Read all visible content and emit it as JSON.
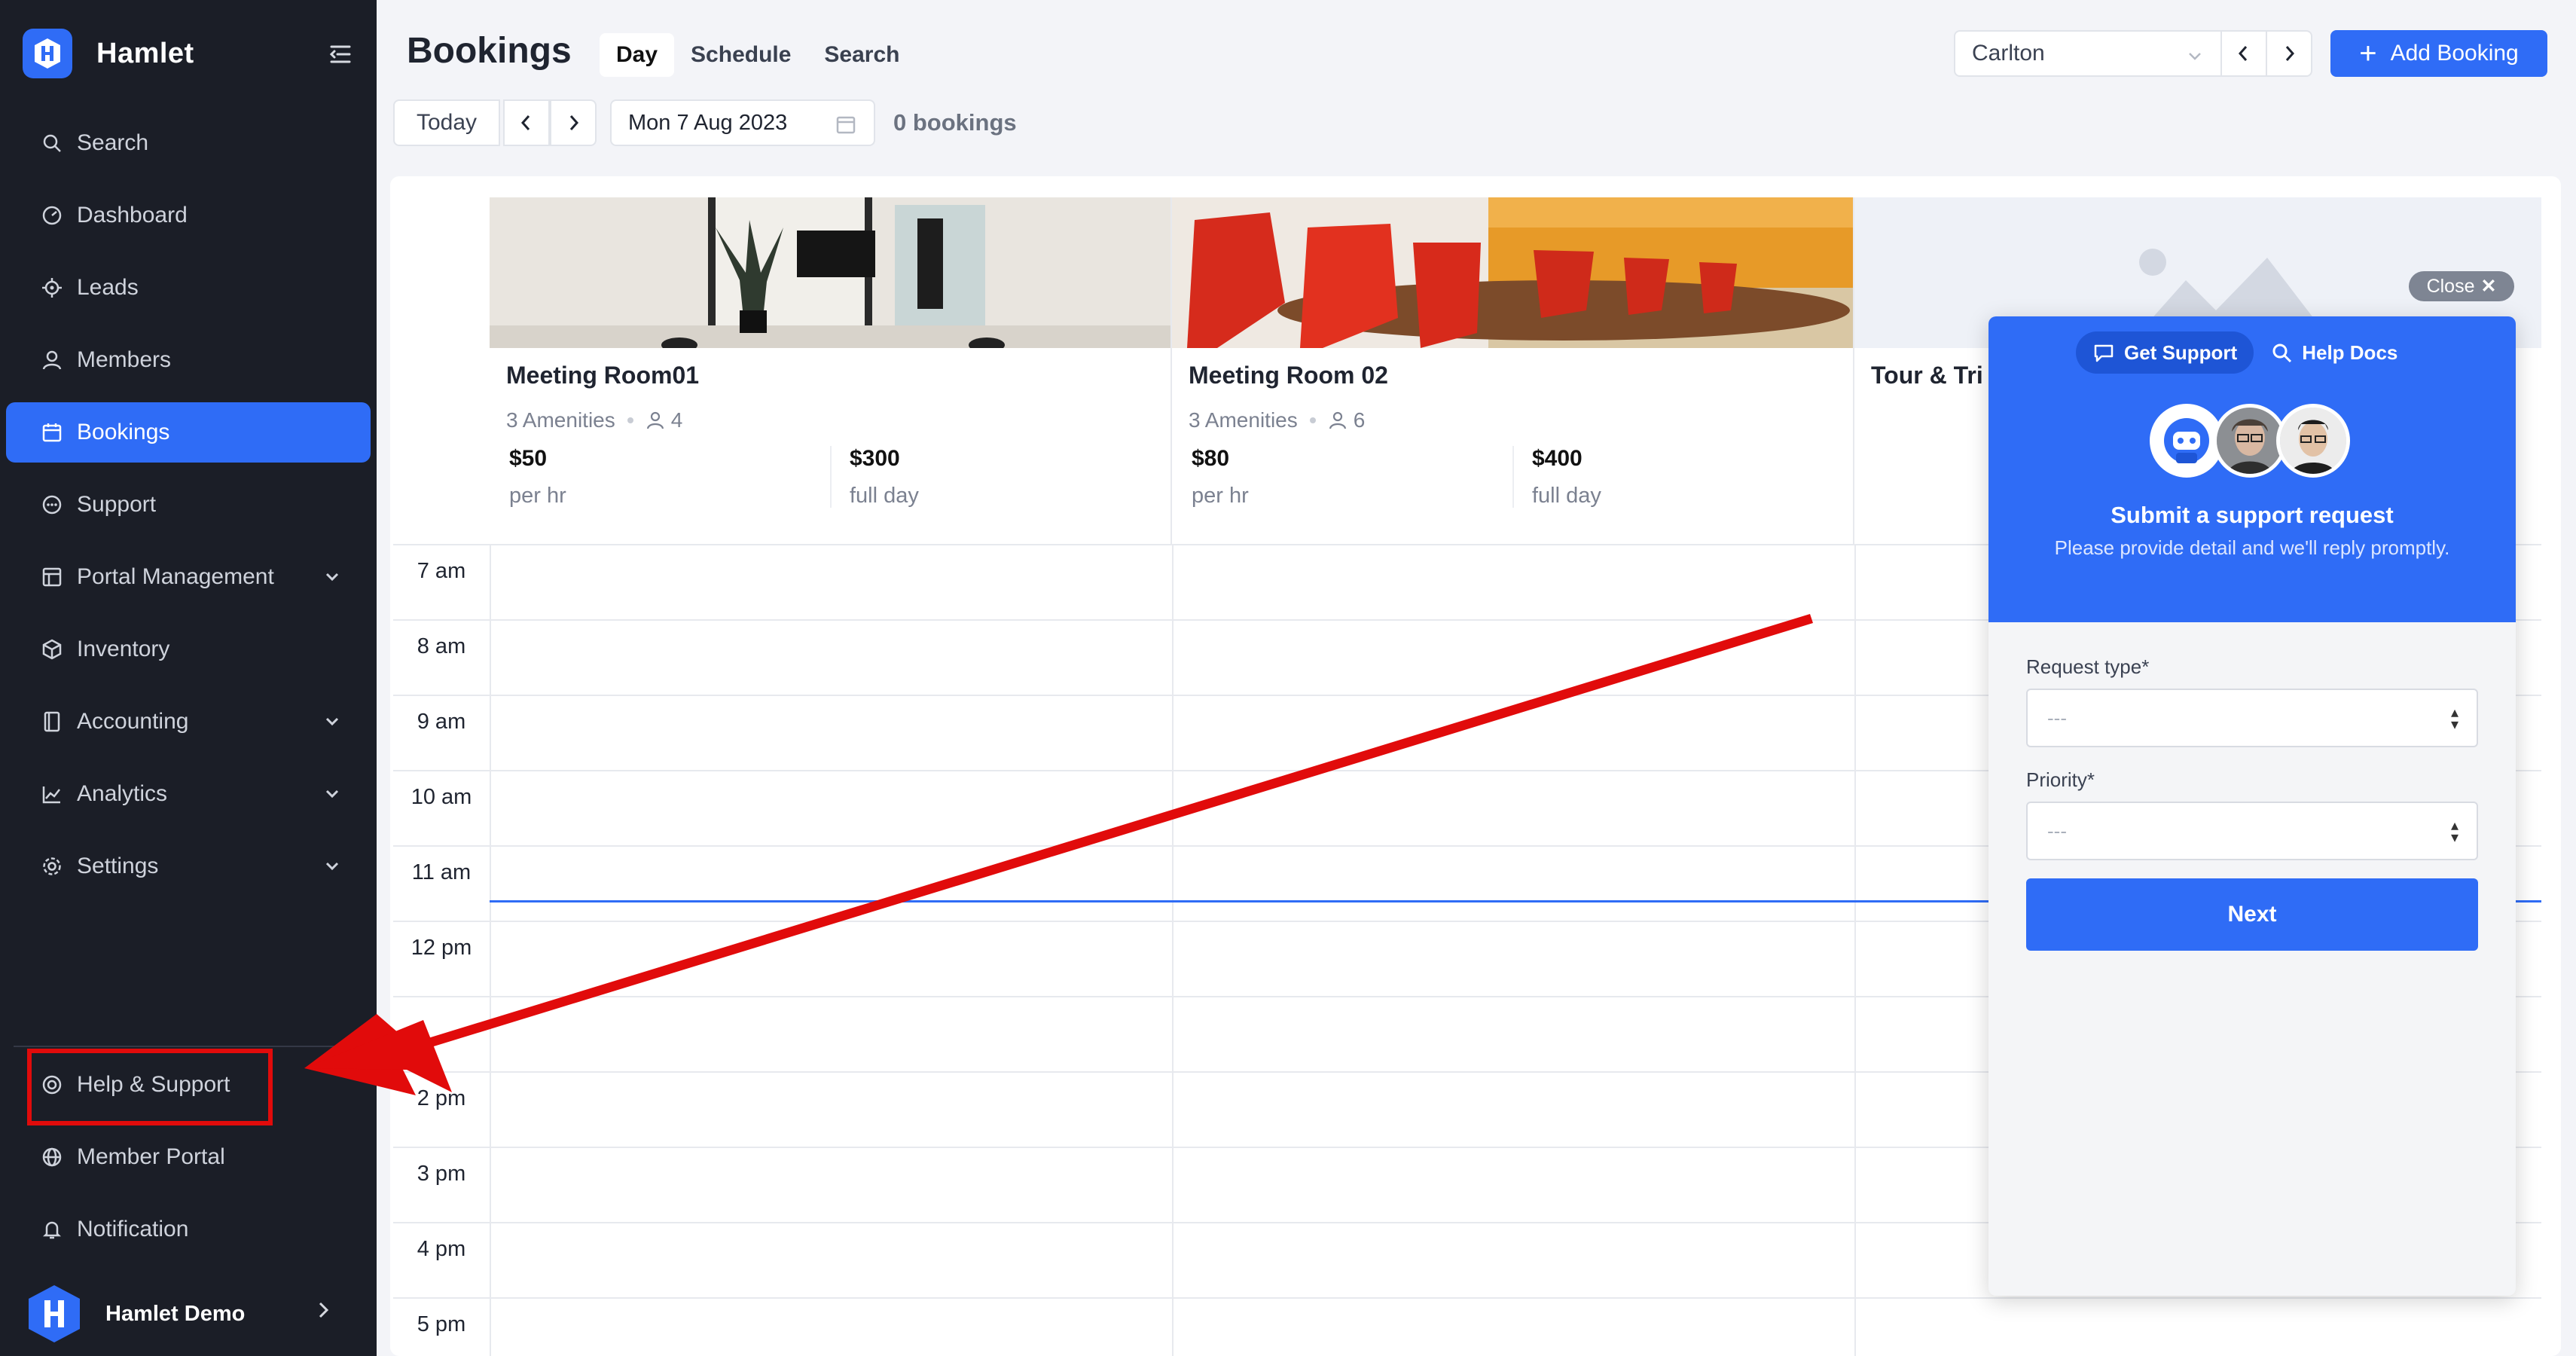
{
  "sidebar": {
    "brand": "Hamlet",
    "items": [
      {
        "label": "Search",
        "icon": "search-icon"
      },
      {
        "label": "Dashboard",
        "icon": "dashboard-icon"
      },
      {
        "label": "Leads",
        "icon": "leads-icon"
      },
      {
        "label": "Members",
        "icon": "members-icon"
      },
      {
        "label": "Bookings",
        "icon": "calendar-icon",
        "active": true
      },
      {
        "label": "Support",
        "icon": "support-icon"
      },
      {
        "label": "Portal Management",
        "icon": "portal-icon",
        "expandable": true
      },
      {
        "label": "Inventory",
        "icon": "inventory-icon"
      },
      {
        "label": "Accounting",
        "icon": "accounting-icon",
        "expandable": true
      },
      {
        "label": "Analytics",
        "icon": "analytics-icon",
        "expandable": true
      },
      {
        "label": "Settings",
        "icon": "settings-icon",
        "expandable": true
      }
    ],
    "bottom_items": [
      {
        "label": "Help & Support",
        "icon": "help-icon"
      },
      {
        "label": "Member Portal",
        "icon": "globe-icon"
      },
      {
        "label": "Notification",
        "icon": "bell-icon"
      }
    ],
    "user": {
      "name": "Hamlet Demo"
    }
  },
  "header": {
    "title": "Bookings",
    "tabs": [
      {
        "label": "Day",
        "active": true
      },
      {
        "label": "Schedule"
      },
      {
        "label": "Search"
      }
    ],
    "location": "Carlton",
    "add_button": "Add Booking",
    "today_button": "Today",
    "date": "Mon 7 Aug 2023",
    "bookings_count": "0 bookings"
  },
  "rooms": [
    {
      "name": "Meeting Room01",
      "amenities": "3 Amenities",
      "capacity": "4",
      "hourly": "$50",
      "hourly_unit": "per hr",
      "daily": "$300",
      "daily_unit": "full day"
    },
    {
      "name": "Meeting Room 02",
      "amenities": "3 Amenities",
      "capacity": "6",
      "hourly": "$80",
      "hourly_unit": "per hr",
      "daily": "$400",
      "daily_unit": "full day"
    },
    {
      "name": "Tour & Tri"
    }
  ],
  "time_slots": [
    "7 am",
    "8 am",
    "9 am",
    "10 am",
    "11 am",
    "12 pm",
    "",
    "2 pm",
    "3 pm",
    "4 pm",
    "5 pm"
  ],
  "support_widget": {
    "close_label": "Close",
    "tab_get_support": "Get Support",
    "tab_help_docs": "Help Docs",
    "title": "Submit a support request",
    "subtitle": "Please provide detail and we'll reply promptly.",
    "request_type_label": "Request type*",
    "request_type_value": "---",
    "priority_label": "Priority*",
    "priority_value": "---",
    "next_label": "Next"
  },
  "colors": {
    "accent": "#2f6cf6",
    "sidebar_bg": "#1b1e27",
    "annotation": "#e10b0b"
  }
}
